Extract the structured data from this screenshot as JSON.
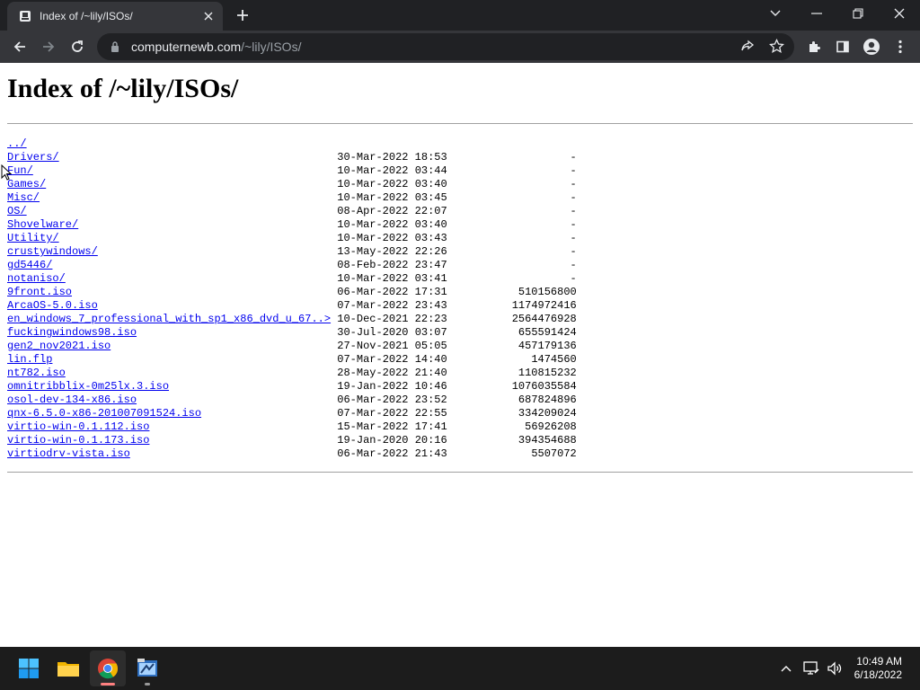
{
  "browser": {
    "tab_title": "Index of /~lily/ISOs/",
    "url_host": "computernewb.com",
    "url_path": "/~lily/ISOs/"
  },
  "page": {
    "heading": "Index of /~lily/ISOs/",
    "parent_link": "../",
    "entries": [
      {
        "name": "Drivers/",
        "date": "30-Mar-2022 18:53",
        "size": "-"
      },
      {
        "name": "Fun/",
        "date": "10-Mar-2022 03:44",
        "size": "-"
      },
      {
        "name": "Games/",
        "date": "10-Mar-2022 03:40",
        "size": "-"
      },
      {
        "name": "Misc/",
        "date": "10-Mar-2022 03:45",
        "size": "-"
      },
      {
        "name": "OS/",
        "date": "08-Apr-2022 22:07",
        "size": "-"
      },
      {
        "name": "Shovelware/",
        "date": "10-Mar-2022 03:40",
        "size": "-"
      },
      {
        "name": "Utility/",
        "date": "10-Mar-2022 03:43",
        "size": "-"
      },
      {
        "name": "crustywindows/",
        "date": "13-May-2022 22:26",
        "size": "-"
      },
      {
        "name": "gd5446/",
        "date": "08-Feb-2022 23:47",
        "size": "-"
      },
      {
        "name": "notaniso/",
        "date": "10-Mar-2022 03:41",
        "size": "-"
      },
      {
        "name": "9front.iso",
        "date": "06-Mar-2022 17:31",
        "size": "510156800"
      },
      {
        "name": "ArcaOS-5.0.iso",
        "date": "07-Mar-2022 23:43",
        "size": "1174972416"
      },
      {
        "name": "en_windows_7_professional_with_sp1_x86_dvd_u_67..>",
        "date": "10-Dec-2021 22:23",
        "size": "2564476928"
      },
      {
        "name": "fuckingwindows98.iso",
        "date": "30-Jul-2020 03:07",
        "size": "655591424"
      },
      {
        "name": "gen2_nov2021.iso",
        "date": "27-Nov-2021 05:05",
        "size": "457179136"
      },
      {
        "name": "lin.flp",
        "date": "07-Mar-2022 14:40",
        "size": "1474560"
      },
      {
        "name": "nt782.iso",
        "date": "28-May-2022 21:40",
        "size": "110815232"
      },
      {
        "name": "omnitribblix-0m25lx.3.iso",
        "date": "19-Jan-2022 10:46",
        "size": "1076035584"
      },
      {
        "name": "osol-dev-134-x86.iso",
        "date": "06-Mar-2022 23:52",
        "size": "687824896"
      },
      {
        "name": "qnx-6.5.0-x86-201007091524.iso",
        "date": "07-Mar-2022 22:55",
        "size": "334209024"
      },
      {
        "name": "virtio-win-0.1.112.iso",
        "date": "15-Mar-2022 17:41",
        "size": "56926208"
      },
      {
        "name": "virtio-win-0.1.173.iso",
        "date": "19-Jan-2020 20:16",
        "size": "394354688"
      },
      {
        "name": "virtiodrv-vista.iso",
        "date": "06-Mar-2022 21:43",
        "size": "5507072"
      }
    ]
  },
  "taskbar": {
    "time": "10:49 AM",
    "date": "6/18/2022",
    "pinned": [
      "start-icon",
      "file-explorer-icon",
      "chrome-icon",
      "network-tool-icon"
    ]
  },
  "colors": {
    "link": "#0000ee",
    "tab_strip": "#202124",
    "toolbar": "#35363a",
    "taskbar": "#1c1c1c"
  }
}
